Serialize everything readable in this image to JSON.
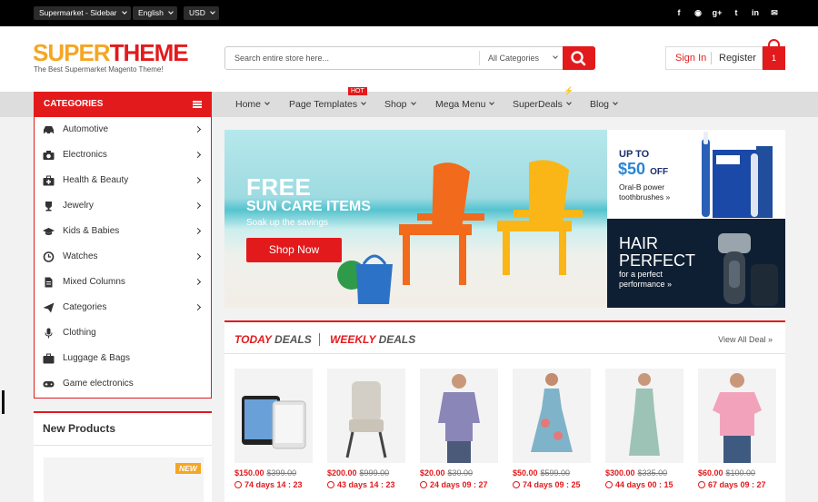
{
  "topbar": {
    "store_selector": "Supermarket - Sidebar",
    "language_selector": "English",
    "currency_selector": "USD",
    "social_icons": [
      "facebook-icon",
      "dribbble-icon",
      "google-plus-icon",
      "twitter-icon",
      "linkedin-icon",
      "email-icon"
    ]
  },
  "header": {
    "logo_part1": "SUPER",
    "logo_part2": "THEME",
    "tagline": "The Best Supermarket Magento Theme!",
    "search_placeholder": "Search entire store here...",
    "search_category": "All Categories",
    "sign_in": "Sign In",
    "register": "Register",
    "cart_count": "1"
  },
  "categories_title": "CATEGORIES",
  "categories": [
    {
      "label": "Automotive",
      "icon": "car-icon",
      "has_submenu": true
    },
    {
      "label": "Electronics",
      "icon": "camera-icon",
      "has_submenu": true
    },
    {
      "label": "Health & Beauty",
      "icon": "medkit-icon",
      "has_submenu": true
    },
    {
      "label": "Jewelry",
      "icon": "trophy-icon",
      "has_submenu": true
    },
    {
      "label": "Kids & Babies",
      "icon": "graduation-cap-icon",
      "has_submenu": true
    },
    {
      "label": "Watches",
      "icon": "clock-icon",
      "has_submenu": true
    },
    {
      "label": "Mixed Columns",
      "icon": "document-icon",
      "has_submenu": true
    },
    {
      "label": "Categories",
      "icon": "paper-plane-icon",
      "has_submenu": true
    },
    {
      "label": "Clothing",
      "icon": "microphone-icon",
      "has_submenu": false
    },
    {
      "label": "Luggage & Bags",
      "icon": "briefcase-icon",
      "has_submenu": false
    },
    {
      "label": "Game electronics",
      "icon": "gamepad-icon",
      "has_submenu": false
    }
  ],
  "nav": [
    {
      "label": "Home"
    },
    {
      "label": "Page Templates",
      "badge": "HOT"
    },
    {
      "label": "Shop"
    },
    {
      "label": "Mega Menu"
    },
    {
      "label": "SuperDeals",
      "badge_icon": "lightning-icon"
    },
    {
      "label": "Blog"
    }
  ],
  "hero": {
    "title": "FREE",
    "subtitle": "SUN CARE ITEMS",
    "tagline": "Soak up the savings",
    "button": "Shop Now"
  },
  "promo_top": {
    "up_to": "UP TO",
    "amount": "$50",
    "off": "OFF",
    "desc": "Oral-B power toothbrushes »"
  },
  "promo_bottom": {
    "title_line1": "HAIR",
    "title_line2": "PERFECT",
    "desc": "for a perfect performance »"
  },
  "deals": {
    "tab1_a": "TODAY",
    "tab1_b": "DEALS",
    "tab2_a": "WEEKLY",
    "tab2_b": "DEALS",
    "view_all": "View All Deal »",
    "products": [
      {
        "price": "$150.00",
        "old_price": "$399.00",
        "timer": "74 days  14 : 23",
        "image": "tablet"
      },
      {
        "price": "$200.00",
        "old_price": "$999.00",
        "timer": "43 days  14 : 23",
        "image": "chair"
      },
      {
        "price": "$20.00",
        "old_price": "$30.00",
        "timer": "24 days  09 : 27",
        "image": "shirt"
      },
      {
        "price": "$50.00",
        "old_price": "$599.00",
        "timer": "74 days  09 : 25",
        "image": "floral-dress"
      },
      {
        "price": "$300.00",
        "old_price": "$335.00",
        "timer": "44 days  00 : 15",
        "image": "lace-dress"
      },
      {
        "price": "$60.00",
        "old_price": "$100.00",
        "timer": "67 days  09 : 27",
        "image": "tshirt"
      }
    ]
  },
  "new_products": {
    "title": "New Products",
    "badge": "NEW"
  },
  "colors": {
    "brand_red": "#e31a1c",
    "brand_orange": "#f5a623",
    "topbar_bg": "#000000",
    "nav_bg": "#dddddd"
  }
}
